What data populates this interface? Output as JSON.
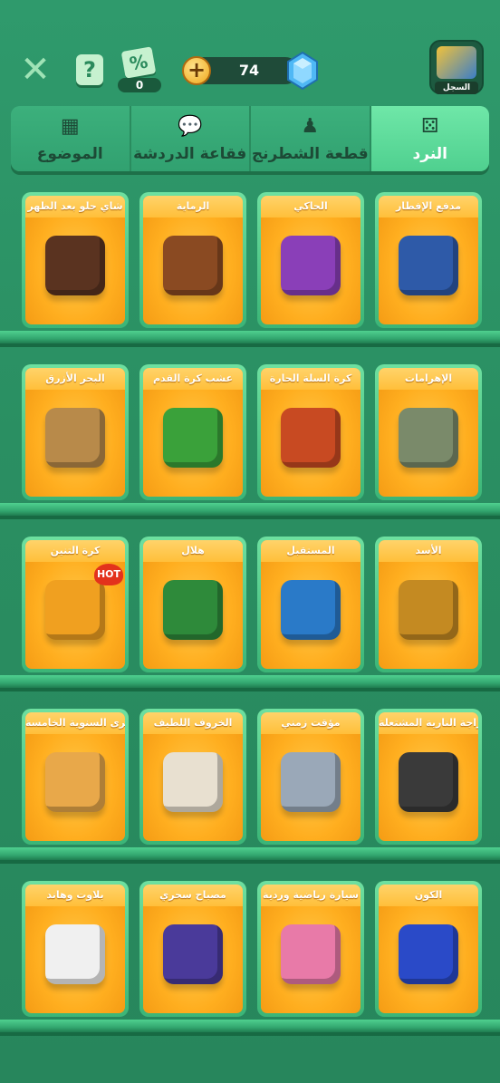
{
  "header": {
    "discount_count": "0",
    "gems": "74",
    "profile_label": "السجل"
  },
  "icons": {
    "close": "close-icon",
    "help": "help-icon",
    "discount": "discount-icon",
    "plus": "plus-icon",
    "gem": "gem-icon"
  },
  "tabs": [
    {
      "label": "الموضوع",
      "icon": "grid-icon"
    },
    {
      "label": "فقاعة الدردشة",
      "icon": "chat-icon"
    },
    {
      "label": "قطعة الشطرنج",
      "icon": "chess-piece-icon"
    },
    {
      "label": "النرد",
      "icon": "dice-icon",
      "active": true
    }
  ],
  "shelves": [
    [
      {
        "title": "مدفع الإفطار",
        "color": "#2e5aa8"
      },
      {
        "title": "الحاكي",
        "color": "#8a3fb8"
      },
      {
        "title": "الرماية",
        "color": "#8a4a22"
      },
      {
        "title": "شاي حلو بعد الظهر",
        "color": "#5a3320"
      }
    ],
    [
      {
        "title": "الإهرامات",
        "color": "#7a8a6a"
      },
      {
        "title": "كرة السلة الحارة",
        "color": "#c84a22"
      },
      {
        "title": "عشب كرة القدم",
        "color": "#3aa13a"
      },
      {
        "title": "البحر الأزرق",
        "color": "#b88a4a"
      }
    ],
    [
      {
        "title": "الأسد",
        "color": "#c48a22"
      },
      {
        "title": "المستقبل",
        "color": "#2a7ac8"
      },
      {
        "title": "هلال",
        "color": "#2e8a3a"
      },
      {
        "title": "كرة التنين",
        "color": "#f0a020",
        "hot": "HOT"
      }
    ],
    [
      {
        "title": "الدراجة النارية المشتعلة",
        "color": "#3a3a3a"
      },
      {
        "title": "مؤقت زمني",
        "color": "#9aa8b8"
      },
      {
        "title": "الخروف اللطيف",
        "color": "#e8e0d0"
      },
      {
        "title": "الذكرى السنوية الخامسة",
        "color": "#e8a84a"
      }
    ],
    [
      {
        "title": "الكون",
        "color": "#2a4ac8"
      },
      {
        "title": "سيارة رياضية وردية",
        "color": "#e87aa8"
      },
      {
        "title": "مصباح سحري",
        "color": "#4a3a9a"
      },
      {
        "title": "بلاوت وهاند",
        "color": "#f0f0f0"
      }
    ]
  ]
}
